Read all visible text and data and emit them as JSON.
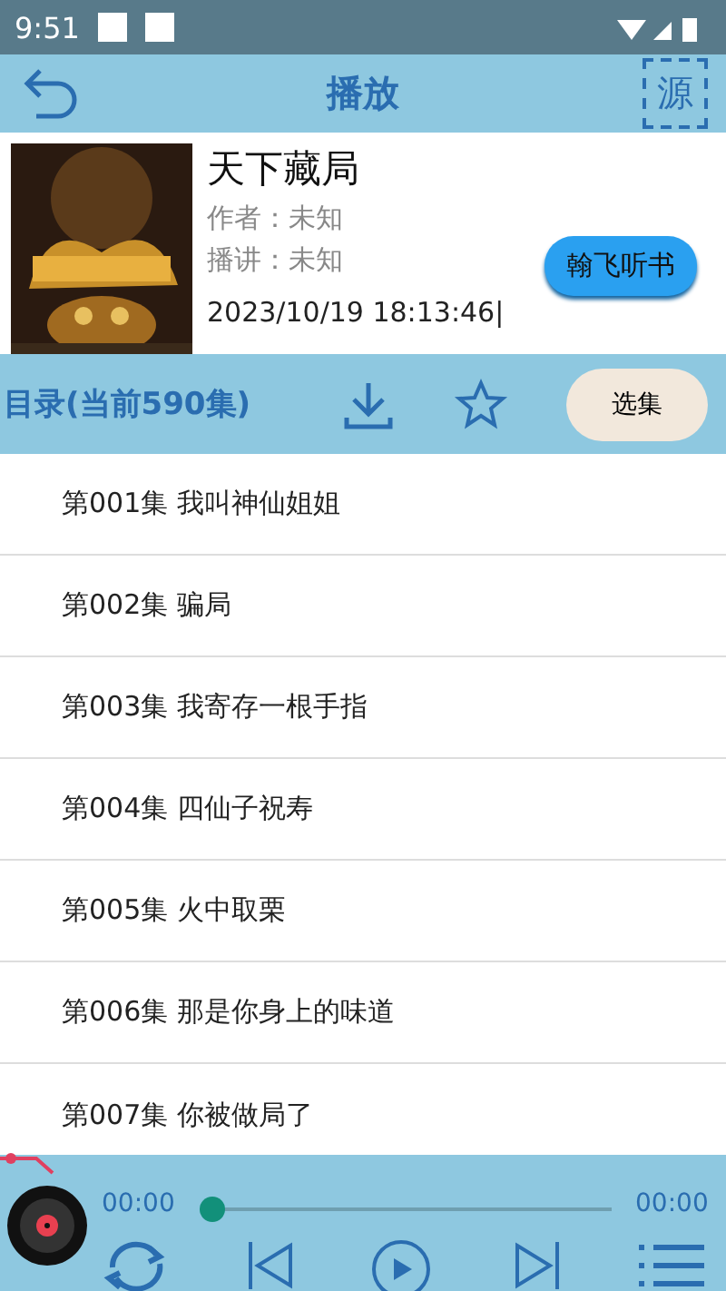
{
  "status_bar": {
    "time": "9:51"
  },
  "header": {
    "title": "播放",
    "source_button": "源"
  },
  "book": {
    "title": "天下藏局",
    "author": "作者：未知",
    "narrator": "播讲：未知",
    "updated": "2023/10/19 18:13:46|",
    "app_button": "翰飞听书"
  },
  "catalog": {
    "title": "目录(当前590集)",
    "select_button": "选集"
  },
  "episodes": [
    {
      "label": "第001集 我叫神仙姐姐"
    },
    {
      "label": "第002集 骗局"
    },
    {
      "label": "第003集 我寄存一根手指"
    },
    {
      "label": "第004集 四仙子祝寿"
    },
    {
      "label": "第005集 火中取栗"
    },
    {
      "label": "第006集 那是你身上的味道"
    },
    {
      "label": "第007集 你被做局了"
    }
  ],
  "player": {
    "elapsed": "00:00",
    "duration": "00:00",
    "level": 0
  }
}
